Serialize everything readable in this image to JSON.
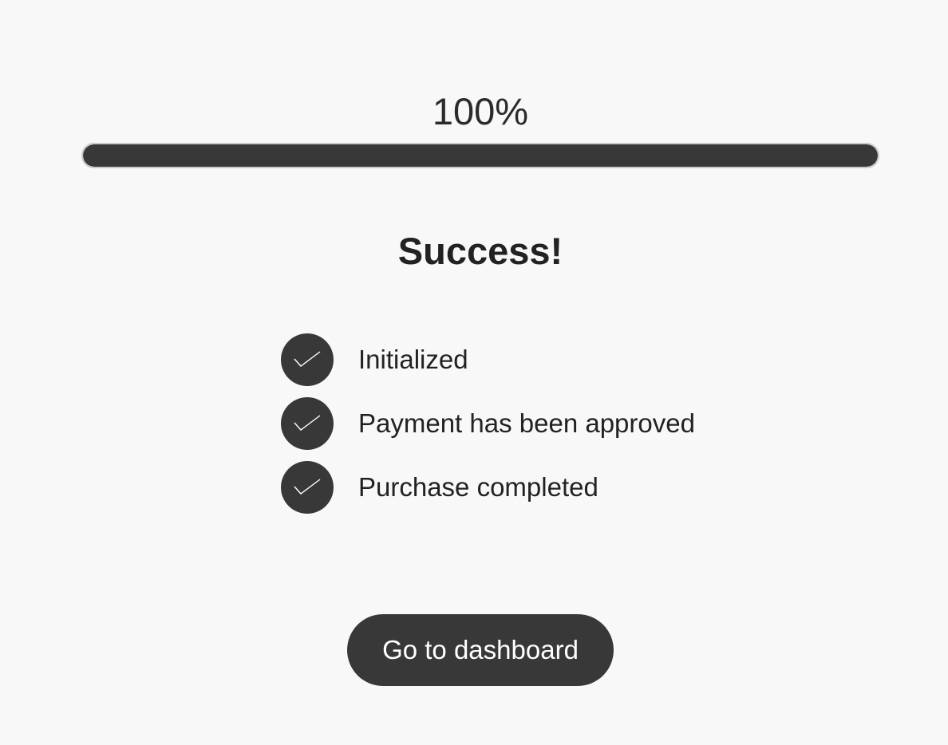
{
  "progress": {
    "label": "100%",
    "fraction": 1.0
  },
  "status": {
    "heading": "Success!"
  },
  "steps": [
    {
      "label": "Initialized",
      "icon": "check-icon",
      "completed": true
    },
    {
      "label": "Payment has been approved",
      "icon": "check-icon",
      "completed": true
    },
    {
      "label": "Purchase completed",
      "icon": "check-icon",
      "completed": true
    }
  ],
  "actions": {
    "dashboard_label": "Go to dashboard"
  },
  "colors": {
    "background": "#f8f8f8",
    "accent": "#383838",
    "text": "#222222"
  }
}
